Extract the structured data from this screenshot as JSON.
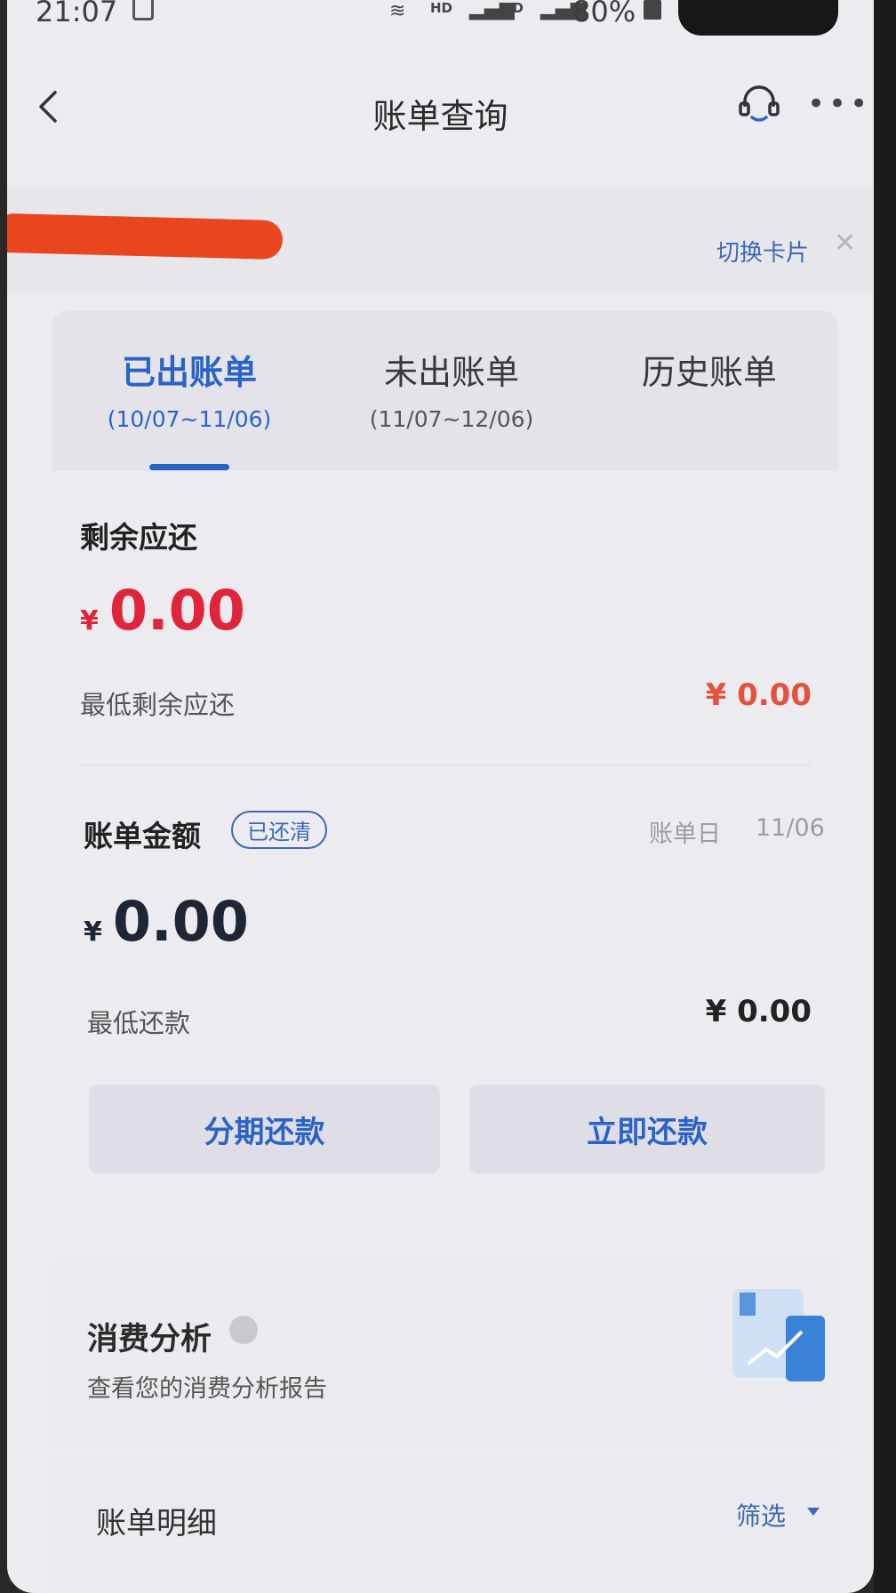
{
  "status_bar": {
    "time": "21:07",
    "network_1": "HD",
    "network_2": "HD",
    "battery": "80%"
  },
  "navbar": {
    "title": "账单查询",
    "icons": [
      "back-icon",
      "customer-service-icon",
      "more-icon"
    ]
  },
  "card_switcher": {
    "switch_label": "切换卡片"
  },
  "tabs": [
    {
      "label": "已出账单",
      "range": "(10/07~11/06)",
      "active": true
    },
    {
      "label": "未出账单",
      "range": "(11/07~12/06)",
      "active": false
    },
    {
      "label": "历史账单",
      "range": "",
      "active": false
    }
  ],
  "remaining": {
    "title": "剩余应还",
    "currency": "¥",
    "amount": "0.00",
    "min_label": "最低剩余应还",
    "min_value": "¥ 0.00"
  },
  "bill": {
    "title": "账单金额",
    "badge": "已还清",
    "bill_day_label": "账单日",
    "bill_day_value": "11/06",
    "currency": "¥",
    "amount": "0.00",
    "min_label": "最低还款",
    "min_value": "¥ 0.00"
  },
  "actions": {
    "installment": "分期还款",
    "repay_now": "立即还款"
  },
  "analysis": {
    "title": "消费分析",
    "subtitle": "查看您的消费分析报告"
  },
  "details": {
    "title": "账单明细",
    "filter": "筛选"
  },
  "colors": {
    "accent_blue": "#2a63c8",
    "amount_red": "#e0243a",
    "background": "#ecebf0"
  }
}
